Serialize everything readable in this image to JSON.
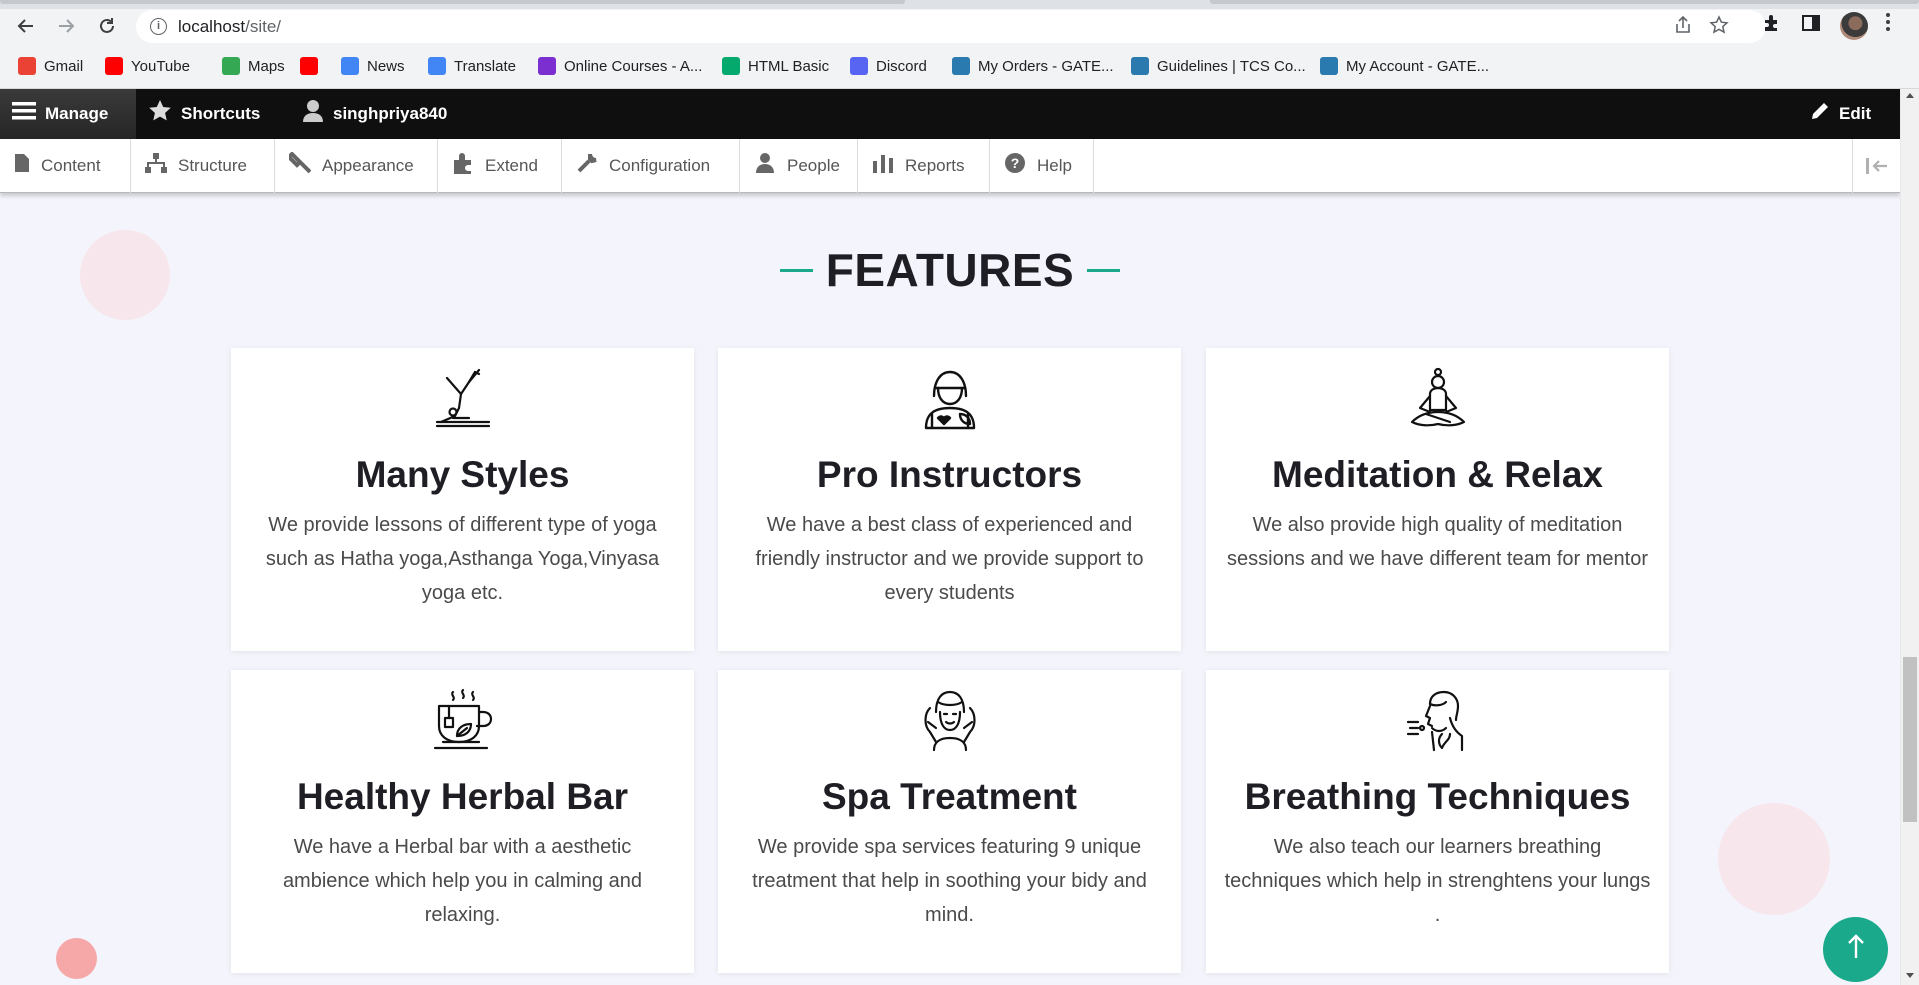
{
  "browser": {
    "url_host": "localhost",
    "url_path": "/site/",
    "bookmarks": [
      {
        "label": "Gmail",
        "icon": "gmail-icon",
        "color": "#ea4335"
      },
      {
        "label": "YouTube",
        "icon": "youtube-icon",
        "color": "#ff0000"
      },
      {
        "label": "Maps",
        "icon": "maps-icon",
        "color": "#34a853"
      },
      {
        "label": "",
        "icon": "youtube-icon",
        "color": "#ff0000"
      },
      {
        "label": "News",
        "icon": "news-icon",
        "color": "#4285f4"
      },
      {
        "label": "Translate",
        "icon": "translate-icon",
        "color": "#4285f4"
      },
      {
        "label": "Online Courses - A...",
        "icon": "courses-icon",
        "color": "#7b2fd0"
      },
      {
        "label": "HTML Basic",
        "icon": "w3schools-icon",
        "color": "#04aa6d"
      },
      {
        "label": "Discord",
        "icon": "discord-icon",
        "color": "#5865f2"
      },
      {
        "label": "My Orders - GATE...",
        "icon": "gate-icon",
        "color": "#2a7ab0"
      },
      {
        "label": "Guidelines | TCS Co...",
        "icon": "tcs-icon",
        "color": "#2a7ab0"
      },
      {
        "label": "My Account - GATE...",
        "icon": "gate-icon",
        "color": "#2a7ab0"
      }
    ]
  },
  "admin": {
    "manage": "Manage",
    "shortcuts": "Shortcuts",
    "user": "singhpriya840",
    "edit": "Edit",
    "tray": [
      {
        "label": "Content",
        "icon": "content-icon"
      },
      {
        "label": "Structure",
        "icon": "structure-icon"
      },
      {
        "label": "Appearance",
        "icon": "appearance-icon"
      },
      {
        "label": "Extend",
        "icon": "extend-icon"
      },
      {
        "label": "Configuration",
        "icon": "configuration-icon"
      },
      {
        "label": "People",
        "icon": "people-icon"
      },
      {
        "label": "Reports",
        "icon": "reports-icon"
      },
      {
        "label": "Help",
        "icon": "help-icon"
      }
    ]
  },
  "features": {
    "title": "FEATURES",
    "accent": "#1aa98a",
    "cards": [
      {
        "title": "Many Styles",
        "icon": "yoga-pose-icon",
        "text": "We provide lessons of different type of yoga such as Hatha yoga,Asthanga Yoga,Vinyasa yoga etc."
      },
      {
        "title": "Pro Instructors",
        "icon": "instructor-icon",
        "text": "We have a best class of experienced and friendly instructor and we provide support to every students"
      },
      {
        "title": "Meditation & Relax",
        "icon": "meditation-icon",
        "text": "We also provide high quality of meditation sessions and we have different team for mentor"
      },
      {
        "title": "Healthy Herbal Bar",
        "icon": "herbal-tea-icon",
        "text": "We have a Herbal bar with a aesthetic ambience which help you in calming and relaxing."
      },
      {
        "title": "Spa Treatment",
        "icon": "spa-icon",
        "text": "We provide spa services featuring 9 unique treatment that help in soothing your bidy and mind."
      },
      {
        "title": "Breathing Techniques",
        "icon": "breathing-icon",
        "text": "We also teach our learners breathing techniques  which help in strenghtens your lungs ."
      }
    ]
  }
}
